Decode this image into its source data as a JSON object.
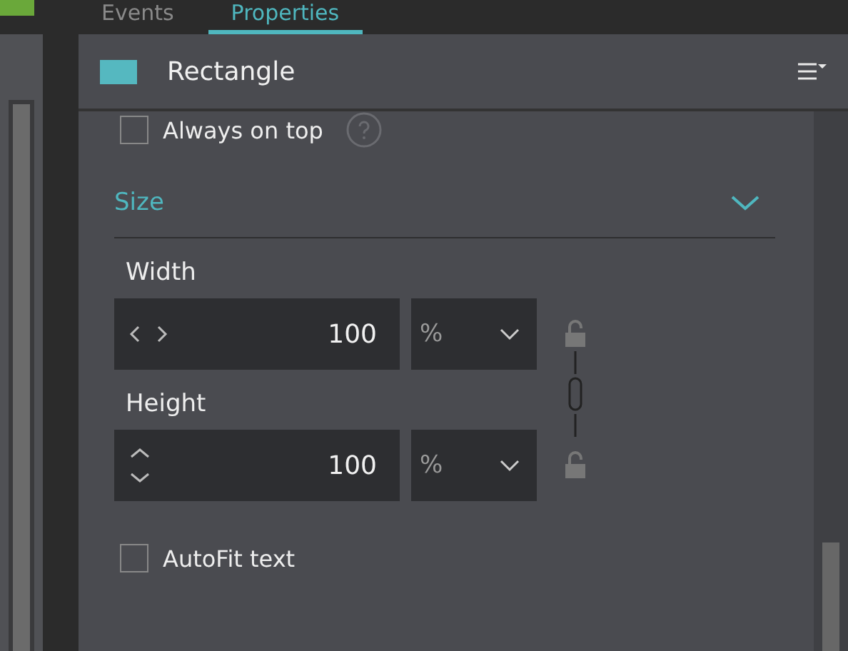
{
  "tabs": [
    {
      "label": "Events",
      "selected": false
    },
    {
      "label": "Properties",
      "selected": true
    }
  ],
  "panel": {
    "title": "Rectangle"
  },
  "always_on_top": {
    "label": "Always on top",
    "checked": false
  },
  "section": {
    "title": "Size",
    "expanded": true
  },
  "fields": [
    {
      "label": "Width",
      "kind": "horizontal",
      "value": "100",
      "unit": "%",
      "locked": false
    },
    {
      "label": "Height",
      "kind": "vertical",
      "value": "100",
      "unit": "%",
      "locked": false
    }
  ],
  "autofit": {
    "label": "AutoFit text",
    "checked": false
  }
}
